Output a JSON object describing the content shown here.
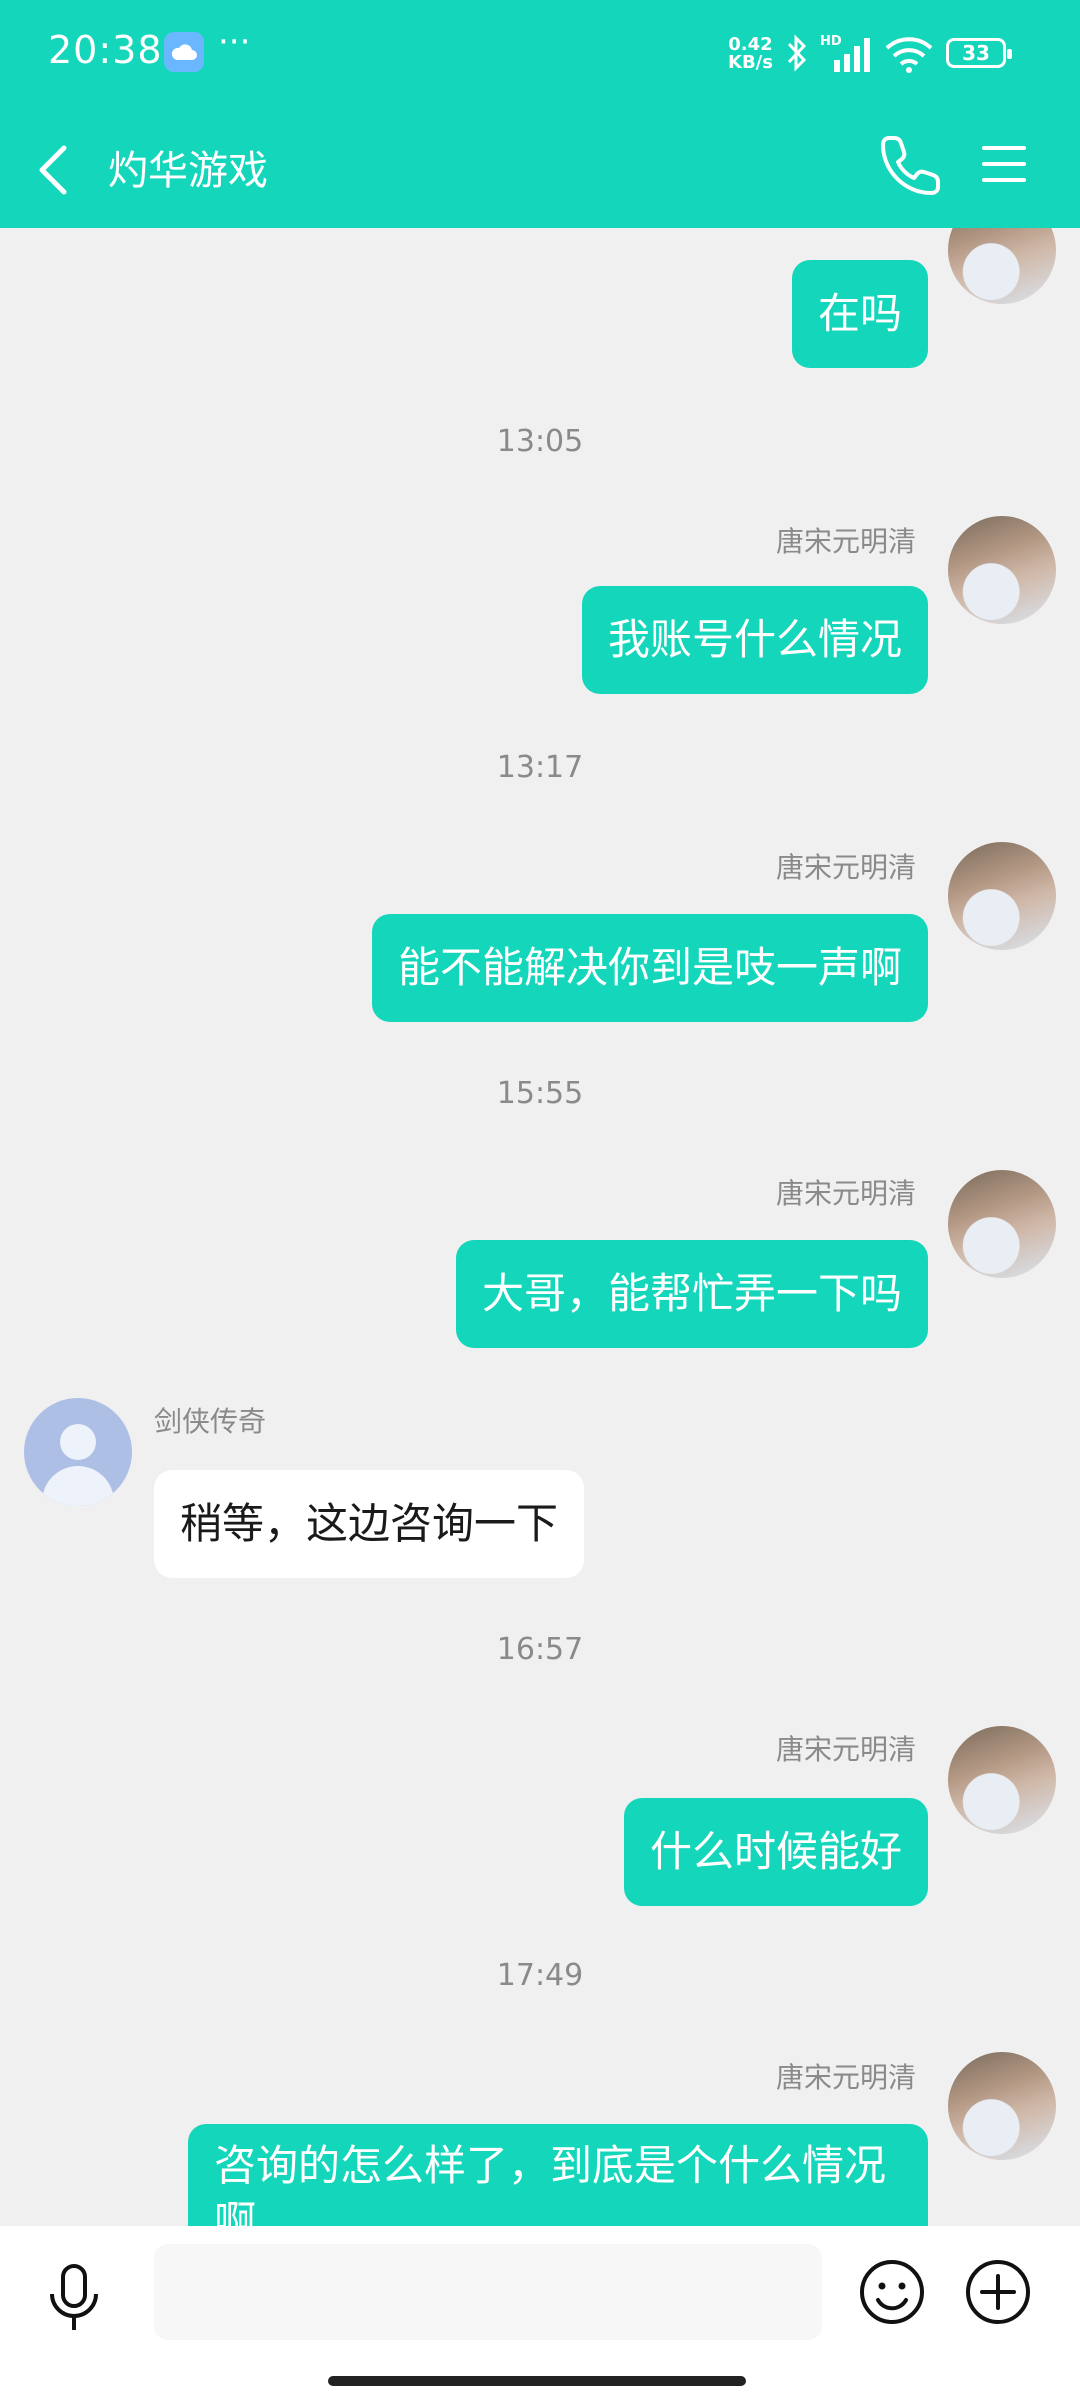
{
  "status_bar": {
    "time": "20:38",
    "net_speed_value": "0.42",
    "net_speed_unit": "KB/s",
    "network_label": "HD",
    "battery": "33"
  },
  "nav": {
    "title": "灼华游戏"
  },
  "messages": [
    {
      "type": "out",
      "text": "在吗"
    },
    {
      "type": "time",
      "text": "13:05"
    },
    {
      "type": "out",
      "sender": "唐宋元明清",
      "text": "我账号什么情况"
    },
    {
      "type": "time",
      "text": "13:17"
    },
    {
      "type": "out",
      "sender": "唐宋元明清",
      "text": "能不能解决你到是吱一声啊"
    },
    {
      "type": "time",
      "text": "15:55"
    },
    {
      "type": "out",
      "sender": "唐宋元明清",
      "text": "大哥，能帮忙弄一下吗"
    },
    {
      "type": "in",
      "sender": "剑侠传奇",
      "text": "稍等，这边咨询一下"
    },
    {
      "type": "time",
      "text": "16:57"
    },
    {
      "type": "out",
      "sender": "唐宋元明清",
      "text": "什么时候能好"
    },
    {
      "type": "time",
      "text": "17:49"
    },
    {
      "type": "out",
      "sender": "唐宋元明清",
      "text": "咨询的怎么样了，到底是个什么情况啊"
    }
  ],
  "input": {
    "placeholder": ""
  },
  "colors": {
    "accent": "#14d6bb",
    "background": "#f0f0f0",
    "incoming_bubble": "#ffffff"
  },
  "icons": [
    "back-arrow-icon",
    "phone-icon",
    "menu-icon",
    "microphone-icon",
    "emoji-icon",
    "plus-icon",
    "bluetooth-icon",
    "signal-icon",
    "wifi-icon",
    "cloud-icon"
  ]
}
